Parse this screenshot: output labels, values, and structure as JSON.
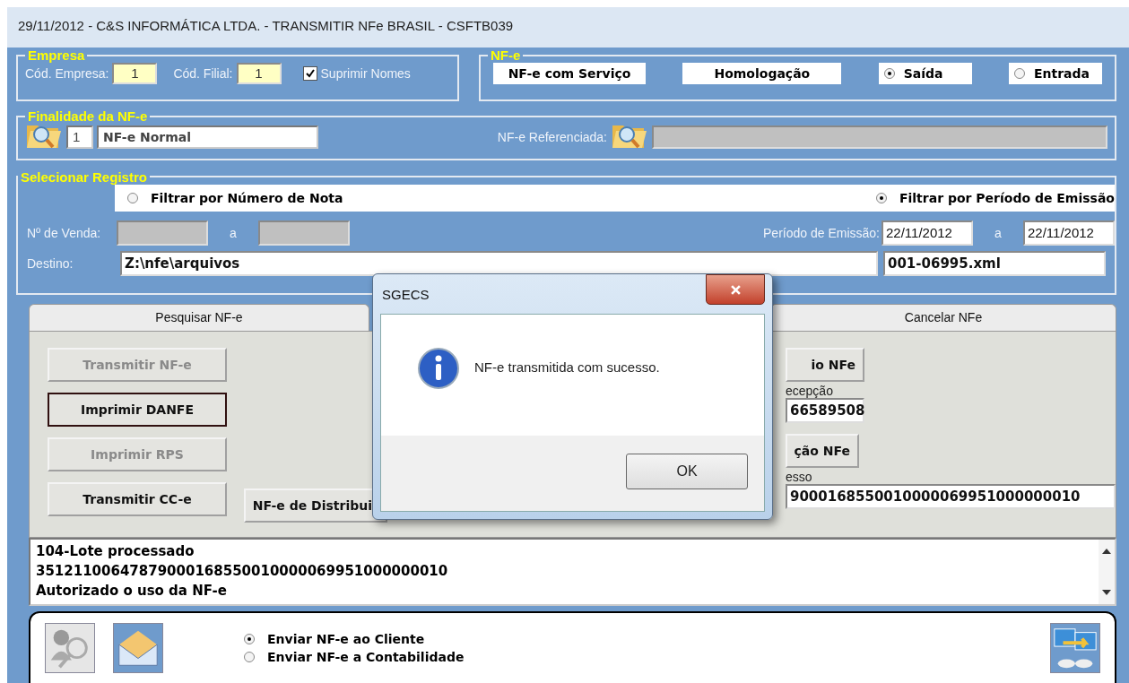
{
  "window": {
    "title": "29/11/2012  -  C&S INFORMÁTICA LTDA.  -  TRANSMITIR NFe BRASIL  -  CSFTB039"
  },
  "empresa": {
    "legend": "Empresa",
    "cod_empresa_label": "Cód. Empresa:",
    "cod_empresa": "1",
    "cod_filial_label": "Cód. Filial:",
    "cod_filial": "1",
    "suprimir": {
      "label": "Suprimir Nomes",
      "checked": true
    }
  },
  "nfe": {
    "legend": "NF-e",
    "tipo": "NF-e com Serviço",
    "ambiente": "Homologação",
    "direcao": [
      {
        "label": "Saída",
        "selected": true
      },
      {
        "label": "Entrada",
        "selected": false
      }
    ]
  },
  "finalidade": {
    "legend": "Finalidade da NF-e",
    "code": "1",
    "value": "NF-e Normal",
    "referenciada_label": "NF-e Referenciada:"
  },
  "registro": {
    "legend": "Selecionar Registro",
    "filters": [
      {
        "label": "Filtrar por Número de Nota",
        "selected": false
      },
      {
        "label": "Filtrar por Período de Emissão",
        "selected": true
      }
    ],
    "venda_label": "Nº de Venda:",
    "venda_sep": "a",
    "periodo_label": "Período de Emissão:",
    "periodo_de": "22/11/2012",
    "periodo_sep": "a",
    "periodo_ate": "22/11/2012",
    "destino_label": "Destino:",
    "destino": "Z:\\nfe\\arquivos",
    "arquivo": "001-06995.xml"
  },
  "tabs": [
    {
      "label": "Pesquisar NF-e",
      "selected": false
    },
    {
      "label": "Cancelar NFe",
      "selected": false
    }
  ],
  "actions": [
    {
      "label": "Transmitir NF-e",
      "disabled": true,
      "focused": false
    },
    {
      "label": "Imprimir DANFE",
      "disabled": false,
      "focused": true
    },
    {
      "label": "Imprimir RPS",
      "disabled": true,
      "focused": false
    },
    {
      "label": "Transmitir CC-e",
      "disabled": false,
      "focused": false
    }
  ],
  "distribuicao_button": "NF-e de Distribui",
  "partial": {
    "button_1": "io NFe",
    "label_1": "ecepção",
    "field_1": "66589508",
    "button_2": "ção NFe",
    "label_2": "esso",
    "field_2": "9000168550010000069951000000010"
  },
  "log": [
    "104-Lote processado",
    "35121100647879000168550010000069951000000010",
    "Autorizado o uso da NF-e"
  ],
  "send_options": [
    {
      "label": "Enviar NF-e ao Cliente",
      "selected": true
    },
    {
      "label": "Enviar NF-e a Contabilidade",
      "selected": false
    }
  ],
  "dialog": {
    "title": "SGECS",
    "message": "NF-e transmitida com sucesso.",
    "button": "OK"
  }
}
